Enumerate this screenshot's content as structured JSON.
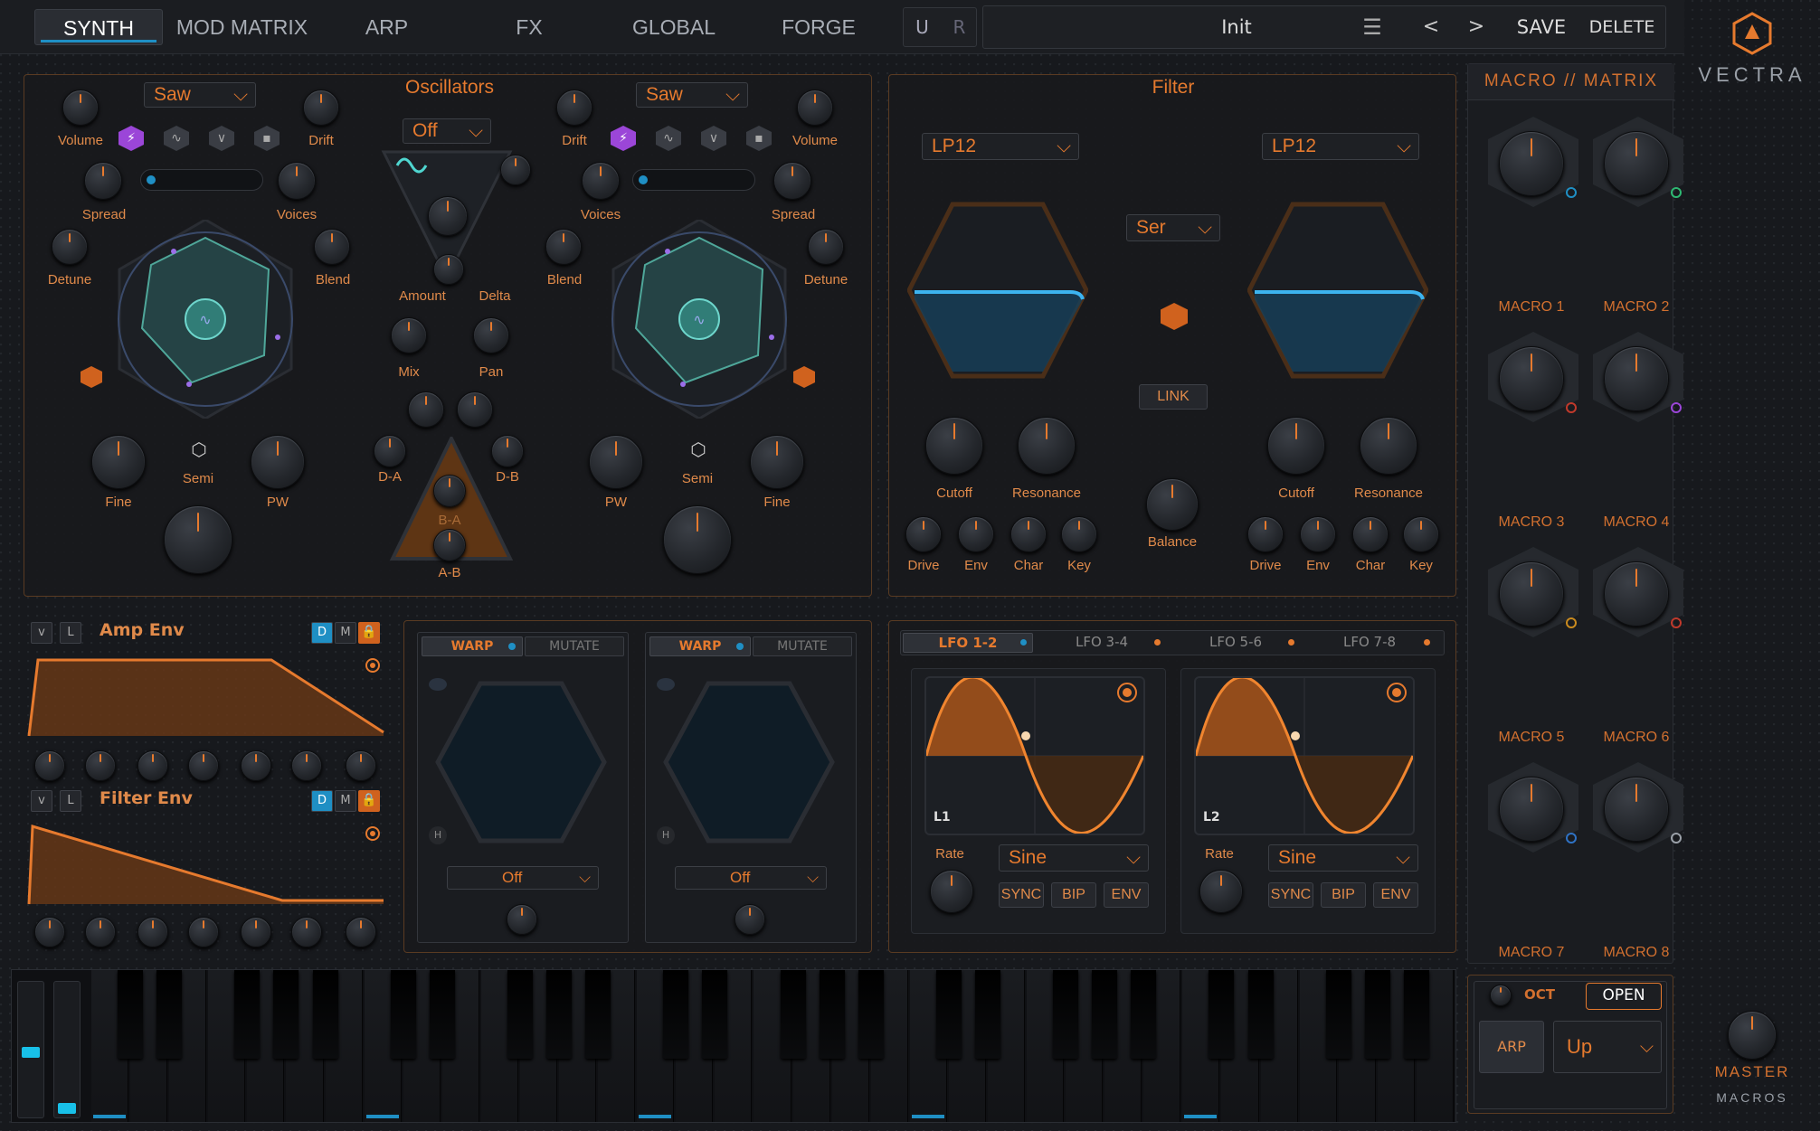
{
  "nav": {
    "tabs": [
      "SYNTH",
      "MOD MATRIX",
      "ARP",
      "FX",
      "GLOBAL",
      "FORGE"
    ],
    "active": "SYNTH",
    "undo": "U",
    "redo": "R",
    "preset_name": "Init",
    "prev": "<",
    "next": ">",
    "save": "SAVE",
    "delete": "DELETE"
  },
  "brand": {
    "name": "VECTRA"
  },
  "oscillators": {
    "title": "Oscillators",
    "osc1": {
      "wave": "Saw",
      "labels": {
        "volume": "Volume",
        "drift": "Drift",
        "spread": "Spread",
        "voices": "Voices",
        "detune": "Detune",
        "blend": "Blend",
        "fine": "Fine",
        "semi": "Semi",
        "pw": "PW"
      }
    },
    "osc2": {
      "wave": "Saw",
      "labels": {
        "drift": "Drift",
        "volume": "Volume",
        "voices": "Voices",
        "spread": "Spread",
        "blend": "Blend",
        "detune": "Detune",
        "pw": "PW",
        "semi": "Semi",
        "fine": "Fine"
      }
    },
    "mixer": {
      "mode": "Off",
      "amount": "Amount",
      "delta": "Delta",
      "mix": "Mix",
      "pan": "Pan",
      "da": "D-A",
      "db": "D-B",
      "ba": "B-A",
      "ab": "A-B"
    }
  },
  "filter": {
    "title": "Filter",
    "f1_type": "LP12",
    "f2_type": "LP12",
    "routing": "Ser",
    "link": "LINK",
    "balance": "Balance",
    "labels": {
      "cutoff": "Cutoff",
      "resonance": "Resonance",
      "drive": "Drive",
      "env": "Env",
      "char": "Char",
      "key": "Key"
    }
  },
  "envelopes": {
    "amp": {
      "title": "Amp Env"
    },
    "filter": {
      "title": "Filter Env"
    },
    "v": "v",
    "l": "L",
    "d": "D",
    "m": "M"
  },
  "warp": {
    "tab_warp": "WARP",
    "tab_mutate": "MUTATE",
    "slot1": "Off",
    "slot2": "Off",
    "h": "H"
  },
  "lfo": {
    "tabs": [
      "LFO 1-2",
      "LFO 3-4",
      "LFO 5-6",
      "LFO 7-8"
    ],
    "l1": {
      "name": "L1",
      "shape": "Sine",
      "rate": "Rate",
      "sync": "SYNC",
      "bip": "BIP",
      "env": "ENV"
    },
    "l2": {
      "name": "L2",
      "shape": "Sine",
      "rate": "Rate",
      "sync": "SYNC",
      "bip": "BIP",
      "env": "ENV"
    }
  },
  "macros": {
    "title": "MACRO // MATRIX",
    "names": [
      "MACRO 1",
      "MACRO 2",
      "MACRO 3",
      "MACRO 4",
      "MACRO 5",
      "MACRO 6",
      "MACRO 7",
      "MACRO 8"
    ],
    "ring_colors": [
      "#1f8fc4",
      "#2eb872",
      "#c0392b",
      "#9b46d8",
      "#c98a1e",
      "#c0392b",
      "#2f72c4",
      "#9aa0a8"
    ]
  },
  "arp_panel": {
    "oct": "OCT",
    "open": "OPEN",
    "arp": "ARP",
    "mode": "Up"
  },
  "master": {
    "label": "MASTER",
    "macros": "MACROS"
  },
  "colors": {
    "accent": "#e67a2e",
    "blue": "#1f8fc4",
    "purple": "#9b46d8"
  }
}
